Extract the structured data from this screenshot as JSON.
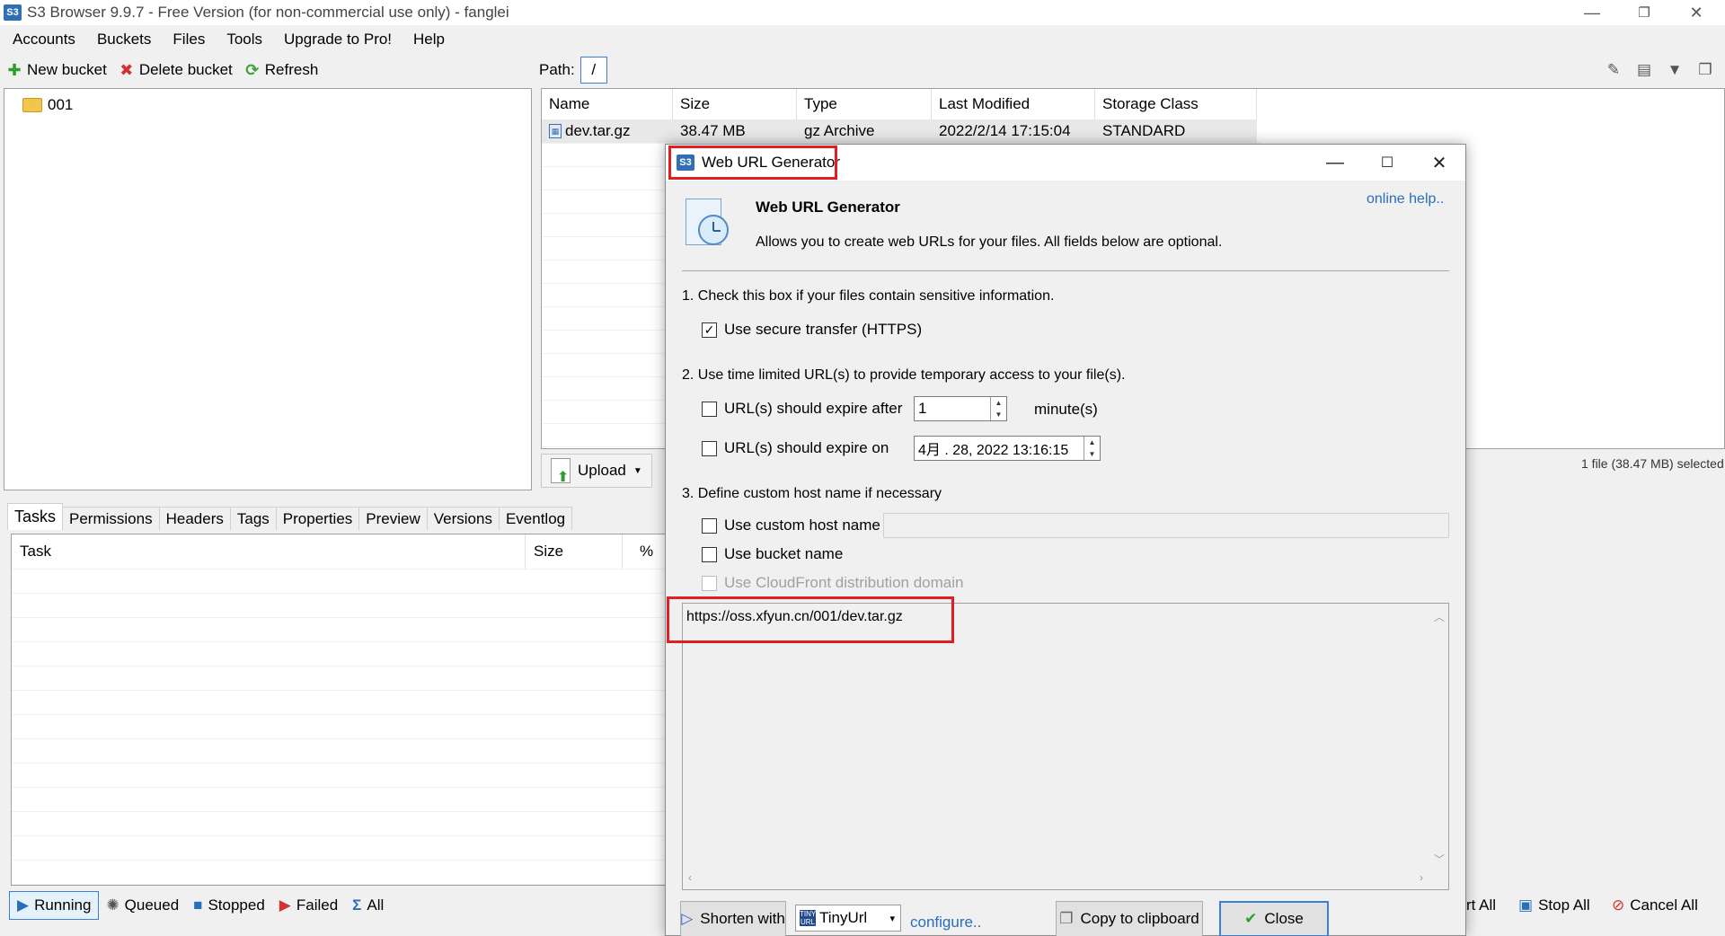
{
  "app": {
    "title": "S3 Browser 9.9.7 - Free Version (for non-commercial use only) - fanglei",
    "icon_text": "S3"
  },
  "menu": [
    "Accounts",
    "Buckets",
    "Files",
    "Tools",
    "Upgrade to Pro!",
    "Help"
  ],
  "toolbar": {
    "new_bucket": "New bucket",
    "delete_bucket": "Delete bucket",
    "refresh": "Refresh"
  },
  "path": {
    "label": "Path:",
    "value": "/"
  },
  "tree": {
    "items": [
      "001"
    ]
  },
  "files": {
    "columns": [
      "Name",
      "Size",
      "Type",
      "Last Modified",
      "Storage Class"
    ],
    "rows": [
      {
        "name": "dev.tar.gz",
        "size": "38.47 MB",
        "type": "gz Archive",
        "modified": "2022/2/14 17:15:04",
        "storage": "STANDARD"
      }
    ],
    "upload_label": "Upload",
    "selection_info": "1 file (38.47 MB) selected"
  },
  "bottom_tabs": [
    "Tasks",
    "Permissions",
    "Headers",
    "Tags",
    "Properties",
    "Preview",
    "Versions",
    "Eventlog"
  ],
  "tasks": {
    "columns": [
      "Task",
      "Size",
      "%"
    ]
  },
  "status_filters": {
    "running": "Running",
    "queued": "Queued",
    "stopped": "Stopped",
    "failed": "Failed",
    "all": "All",
    "start_all": "rt All",
    "stop_all": "Stop All",
    "cancel_all": "Cancel All"
  },
  "dialog": {
    "title": "Web URL Generator",
    "heading": "Web URL Generator",
    "description": "Allows you to create web URLs for your files. All fields below are optional.",
    "online_help": "online help..",
    "step1": "1. Check this box if your files contain sensitive information.",
    "https_label": "Use secure transfer (HTTPS)",
    "https_checked": true,
    "step2": "2. Use time limited URL(s) to provide temporary access to your file(s).",
    "expire_after_label": "URL(s) should expire after",
    "expire_after_value": "1",
    "expire_after_unit": "minute(s)",
    "expire_on_label": "URL(s) should expire on",
    "expire_on_value": "4月 . 28, 2022 13:16:15",
    "step3": "3. Define custom host name if necessary",
    "custom_host_label": "Use custom host name",
    "custom_host_value": "",
    "bucket_name_label": "Use bucket name",
    "cloudfront_label": "Use CloudFront distribution domain",
    "generated_url": "https://oss.xfyun.cn/001/dev.tar.gz",
    "shorten_label": "Shorten with",
    "shortener_value": "TinyUrl",
    "configure_label": "configure..",
    "copy_label": "Copy to clipboard",
    "close_label": "Close"
  },
  "colors": {
    "highlight_red": "#e02020",
    "accent_blue": "#3c7fd9",
    "link_blue": "#2a6ebb"
  }
}
